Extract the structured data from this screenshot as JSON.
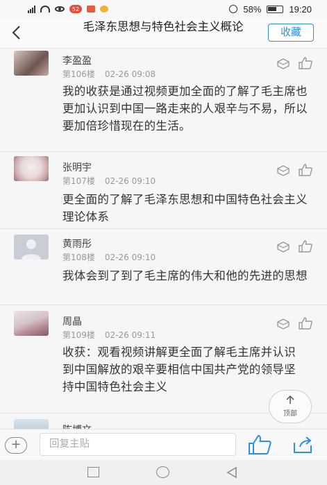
{
  "status": {
    "signal_label": "4G",
    "notif_count": "52",
    "battery": "58%",
    "time": "19:20"
  },
  "header": {
    "title": "毛泽东思想与特色社会主义概论",
    "collect_label": "收藏",
    "back_icon": "chevron-left-icon"
  },
  "posts": [
    {
      "author": "李盈盈",
      "floor": "第106楼",
      "time": "02-26 09:08",
      "content": "我的收获是通过视频更加全面的了解了毛主席也更加认识到中国一路走来的人艰辛与不易，所以要加倍珍惜现在的生活。"
    },
    {
      "author": "张明宇",
      "floor": "第107楼",
      "time": "02-26 09:10",
      "content": "更全面的了解了毛泽东思想和中国特色社会主义理论体系"
    },
    {
      "author": "黄雨彤",
      "floor": "第108楼",
      "time": "02-26 09:10",
      "content": "我体会到了到了毛主席的伟大和他的先进的思想"
    },
    {
      "author": "周晶",
      "floor": "第109楼",
      "time": "02-26 09:11",
      "content": "收获：观看视频讲解更全面了解毛主席并认识到中国解放的艰辛要相信中国共产党的领导坚持中国特色社会主义"
    },
    {
      "author": "陈博文",
      "floor": "",
      "time": "",
      "content": ""
    }
  ],
  "top_button": {
    "label": "顶部"
  },
  "bottom": {
    "plus_label": "+",
    "reply_placeholder": "回复主贴"
  },
  "colors": {
    "accent": "#2c8fe6",
    "icon_gray": "#999999",
    "bottom_icon": "#2c8fe6"
  }
}
